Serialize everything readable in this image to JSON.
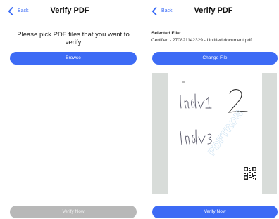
{
  "left_screen": {
    "back_label": "Back",
    "title": "Verify PDF",
    "prompt": "Please pick PDF files that you want to verify",
    "browse_label": "Browse",
    "verify_label": "Verify Now",
    "verify_enabled": false
  },
  "right_screen": {
    "back_label": "Back",
    "title": "Verify PDF",
    "selected_file_label": "Selected File:",
    "selected_file_name": "Certified - 270821142329 - Untitled document.pdf",
    "change_file_label": "Change File",
    "verify_label": "Verify Now",
    "verify_enabled": true
  },
  "preview": {
    "watermark_text": "PDFTRON"
  },
  "colors": {
    "accent": "#3d6bf5",
    "disabled": "#b8b8b8",
    "preview_background": "#d8dcd9"
  }
}
